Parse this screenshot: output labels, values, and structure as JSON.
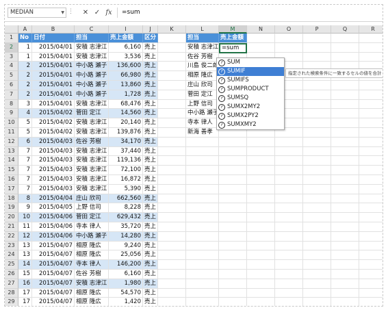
{
  "formula_bar": {
    "name_box": "MEDIAN",
    "dots": "⋮",
    "cancel_symbol": "✕",
    "enter_symbol": "✓",
    "fx_symbol": "fx",
    "formula": "=sum"
  },
  "columns": [
    "A",
    "B",
    "C",
    "I",
    "J",
    "K",
    "L",
    "M",
    "N",
    "O",
    "P",
    "Q",
    "R"
  ],
  "row_numbers": [
    "1",
    "2",
    "3",
    "4",
    "5",
    "6",
    "7",
    "8",
    "9",
    "10",
    "11",
    "12",
    "13",
    "14",
    "15",
    "16",
    "17",
    "18",
    "19",
    "20",
    "21",
    "22",
    "23",
    "24",
    "25",
    "26",
    "27",
    "28",
    "29"
  ],
  "left_table": {
    "headers": [
      "No",
      "日付",
      "担当",
      "売上金額",
      "区分"
    ],
    "rows": [
      {
        "no": "1",
        "date": "2015/04/01",
        "rep": "安積 志津江",
        "amount": "6,160",
        "kind": "売上"
      },
      {
        "no": "1",
        "date": "2015/04/01",
        "rep": "安積 志津江",
        "amount": "3,536",
        "kind": "売上"
      },
      {
        "no": "2",
        "date": "2015/04/01",
        "rep": "中小路 瀬子",
        "amount": "136,600",
        "kind": "売上"
      },
      {
        "no": "2",
        "date": "2015/04/01",
        "rep": "中小路 瀬子",
        "amount": "66,980",
        "kind": "売上"
      },
      {
        "no": "2",
        "date": "2015/04/01",
        "rep": "中小路 瀬子",
        "amount": "13,860",
        "kind": "売上"
      },
      {
        "no": "2",
        "date": "2015/04/01",
        "rep": "中小路 瀬子",
        "amount": "1,728",
        "kind": "売上"
      },
      {
        "no": "3",
        "date": "2015/04/01",
        "rep": "安積 志津江",
        "amount": "68,476",
        "kind": "売上"
      },
      {
        "no": "4",
        "date": "2015/04/02",
        "rep": "菅田 定江",
        "amount": "14,560",
        "kind": "売上"
      },
      {
        "no": "5",
        "date": "2015/04/02",
        "rep": "安積 志津江",
        "amount": "20,140",
        "kind": "売上"
      },
      {
        "no": "5",
        "date": "2015/04/02",
        "rep": "安積 志津江",
        "amount": "139,876",
        "kind": "売上"
      },
      {
        "no": "6",
        "date": "2015/04/03",
        "rep": "佐谷 芳樹",
        "amount": "34,170",
        "kind": "売上"
      },
      {
        "no": "7",
        "date": "2015/04/03",
        "rep": "安積 志津江",
        "amount": "37,440",
        "kind": "売上"
      },
      {
        "no": "7",
        "date": "2015/04/03",
        "rep": "安積 志津江",
        "amount": "119,136",
        "kind": "売上"
      },
      {
        "no": "7",
        "date": "2015/04/03",
        "rep": "安積 志津江",
        "amount": "72,100",
        "kind": "売上"
      },
      {
        "no": "7",
        "date": "2015/04/03",
        "rep": "安積 志津江",
        "amount": "16,872",
        "kind": "売上"
      },
      {
        "no": "7",
        "date": "2015/04/03",
        "rep": "安積 志津江",
        "amount": "5,390",
        "kind": "売上"
      },
      {
        "no": "8",
        "date": "2015/04/04",
        "rep": "庄山 欣司",
        "amount": "662,560",
        "kind": "売上"
      },
      {
        "no": "9",
        "date": "2015/04/05",
        "rep": "上野 信司",
        "amount": "8,228",
        "kind": "売上"
      },
      {
        "no": "10",
        "date": "2015/04/06",
        "rep": "菅田 定江",
        "amount": "629,432",
        "kind": "売上"
      },
      {
        "no": "11",
        "date": "2015/04/06",
        "rep": "寺本 律人",
        "amount": "35,720",
        "kind": "売上"
      },
      {
        "no": "12",
        "date": "2015/04/06",
        "rep": "中小路 瀬子",
        "amount": "14,280",
        "kind": "売上"
      },
      {
        "no": "13",
        "date": "2015/04/07",
        "rep": "相原 隆広",
        "amount": "9,240",
        "kind": "売上"
      },
      {
        "no": "13",
        "date": "2015/04/07",
        "rep": "相原 隆広",
        "amount": "25,056",
        "kind": "売上"
      },
      {
        "no": "14",
        "date": "2015/04/07",
        "rep": "寺本 律人",
        "amount": "146,200",
        "kind": "売上"
      },
      {
        "no": "15",
        "date": "2015/04/07",
        "rep": "佐谷 芳樹",
        "amount": "6,160",
        "kind": "売上"
      },
      {
        "no": "16",
        "date": "2015/04/07",
        "rep": "安積 志津江",
        "amount": "1,980",
        "kind": "売上"
      },
      {
        "no": "17",
        "date": "2015/04/07",
        "rep": "相原 隆広",
        "amount": "54,570",
        "kind": "売上"
      },
      {
        "no": "17",
        "date": "2015/04/07",
        "rep": "相原 隆広",
        "amount": "1,420",
        "kind": "売上"
      }
    ]
  },
  "right_table": {
    "headers": [
      "担当",
      "売上金額"
    ],
    "names": [
      "安積 志津江",
      "佐谷 芳樹",
      "川島 俊二郎",
      "相原 隆広",
      "庄山 欣司",
      "菅田 定江",
      "上野 信司",
      "中小路 瀬子",
      "寺本 律人",
      "新海 善孝"
    ],
    "active_cell_value": "=sum"
  },
  "autocomplete": {
    "items": [
      "SUM",
      "SUMIF",
      "SUMIFS",
      "SUMPRODUCT",
      "SUMSQ",
      "SUMX2MY2",
      "SUMX2PY2",
      "SUMXMY2"
    ],
    "selected": "SUMIF",
    "icon_symbol": "f",
    "tooltip": "指定された検索条件に一致するセルの値を合計します。"
  },
  "colors": {
    "header_blue": "#4a90d9",
    "band_blue": "#d6e6f6",
    "excel_green": "#217346",
    "autocomplete_highlight": "#3f7fd4"
  }
}
